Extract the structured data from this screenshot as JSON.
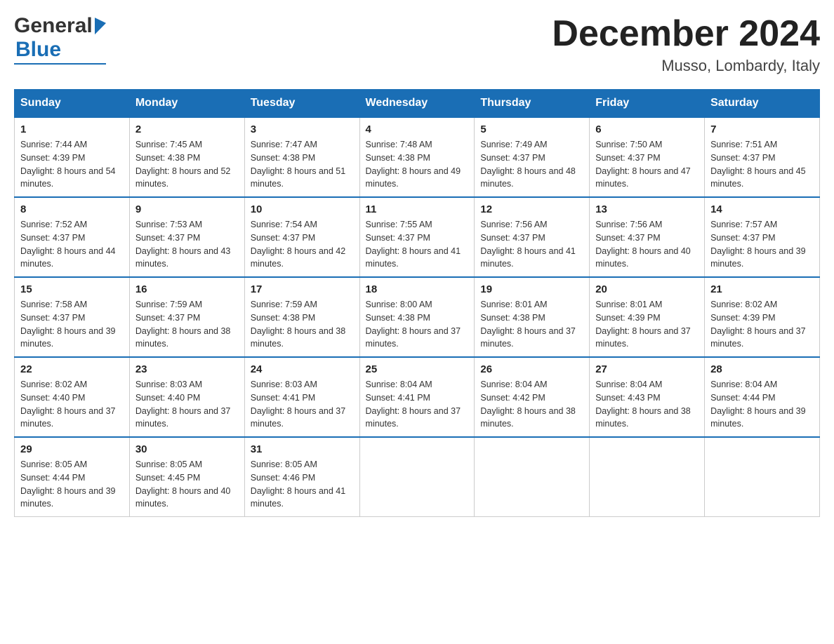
{
  "header": {
    "month_title": "December 2024",
    "location": "Musso, Lombardy, Italy",
    "logo_general": "General",
    "logo_blue": "Blue"
  },
  "calendar": {
    "days_of_week": [
      "Sunday",
      "Monday",
      "Tuesday",
      "Wednesday",
      "Thursday",
      "Friday",
      "Saturday"
    ],
    "weeks": [
      [
        {
          "day": "1",
          "sunrise": "7:44 AM",
          "sunset": "4:39 PM",
          "daylight": "8 hours and 54 minutes."
        },
        {
          "day": "2",
          "sunrise": "7:45 AM",
          "sunset": "4:38 PM",
          "daylight": "8 hours and 52 minutes."
        },
        {
          "day": "3",
          "sunrise": "7:47 AM",
          "sunset": "4:38 PM",
          "daylight": "8 hours and 51 minutes."
        },
        {
          "day": "4",
          "sunrise": "7:48 AM",
          "sunset": "4:38 PM",
          "daylight": "8 hours and 49 minutes."
        },
        {
          "day": "5",
          "sunrise": "7:49 AM",
          "sunset": "4:37 PM",
          "daylight": "8 hours and 48 minutes."
        },
        {
          "day": "6",
          "sunrise": "7:50 AM",
          "sunset": "4:37 PM",
          "daylight": "8 hours and 47 minutes."
        },
        {
          "day": "7",
          "sunrise": "7:51 AM",
          "sunset": "4:37 PM",
          "daylight": "8 hours and 45 minutes."
        }
      ],
      [
        {
          "day": "8",
          "sunrise": "7:52 AM",
          "sunset": "4:37 PM",
          "daylight": "8 hours and 44 minutes."
        },
        {
          "day": "9",
          "sunrise": "7:53 AM",
          "sunset": "4:37 PM",
          "daylight": "8 hours and 43 minutes."
        },
        {
          "day": "10",
          "sunrise": "7:54 AM",
          "sunset": "4:37 PM",
          "daylight": "8 hours and 42 minutes."
        },
        {
          "day": "11",
          "sunrise": "7:55 AM",
          "sunset": "4:37 PM",
          "daylight": "8 hours and 41 minutes."
        },
        {
          "day": "12",
          "sunrise": "7:56 AM",
          "sunset": "4:37 PM",
          "daylight": "8 hours and 41 minutes."
        },
        {
          "day": "13",
          "sunrise": "7:56 AM",
          "sunset": "4:37 PM",
          "daylight": "8 hours and 40 minutes."
        },
        {
          "day": "14",
          "sunrise": "7:57 AM",
          "sunset": "4:37 PM",
          "daylight": "8 hours and 39 minutes."
        }
      ],
      [
        {
          "day": "15",
          "sunrise": "7:58 AM",
          "sunset": "4:37 PM",
          "daylight": "8 hours and 39 minutes."
        },
        {
          "day": "16",
          "sunrise": "7:59 AM",
          "sunset": "4:37 PM",
          "daylight": "8 hours and 38 minutes."
        },
        {
          "day": "17",
          "sunrise": "7:59 AM",
          "sunset": "4:38 PM",
          "daylight": "8 hours and 38 minutes."
        },
        {
          "day": "18",
          "sunrise": "8:00 AM",
          "sunset": "4:38 PM",
          "daylight": "8 hours and 37 minutes."
        },
        {
          "day": "19",
          "sunrise": "8:01 AM",
          "sunset": "4:38 PM",
          "daylight": "8 hours and 37 minutes."
        },
        {
          "day": "20",
          "sunrise": "8:01 AM",
          "sunset": "4:39 PM",
          "daylight": "8 hours and 37 minutes."
        },
        {
          "day": "21",
          "sunrise": "8:02 AM",
          "sunset": "4:39 PM",
          "daylight": "8 hours and 37 minutes."
        }
      ],
      [
        {
          "day": "22",
          "sunrise": "8:02 AM",
          "sunset": "4:40 PM",
          "daylight": "8 hours and 37 minutes."
        },
        {
          "day": "23",
          "sunrise": "8:03 AM",
          "sunset": "4:40 PM",
          "daylight": "8 hours and 37 minutes."
        },
        {
          "day": "24",
          "sunrise": "8:03 AM",
          "sunset": "4:41 PM",
          "daylight": "8 hours and 37 minutes."
        },
        {
          "day": "25",
          "sunrise": "8:04 AM",
          "sunset": "4:41 PM",
          "daylight": "8 hours and 37 minutes."
        },
        {
          "day": "26",
          "sunrise": "8:04 AM",
          "sunset": "4:42 PM",
          "daylight": "8 hours and 38 minutes."
        },
        {
          "day": "27",
          "sunrise": "8:04 AM",
          "sunset": "4:43 PM",
          "daylight": "8 hours and 38 minutes."
        },
        {
          "day": "28",
          "sunrise": "8:04 AM",
          "sunset": "4:44 PM",
          "daylight": "8 hours and 39 minutes."
        }
      ],
      [
        {
          "day": "29",
          "sunrise": "8:05 AM",
          "sunset": "4:44 PM",
          "daylight": "8 hours and 39 minutes."
        },
        {
          "day": "30",
          "sunrise": "8:05 AM",
          "sunset": "4:45 PM",
          "daylight": "8 hours and 40 minutes."
        },
        {
          "day": "31",
          "sunrise": "8:05 AM",
          "sunset": "4:46 PM",
          "daylight": "8 hours and 41 minutes."
        },
        null,
        null,
        null,
        null
      ]
    ]
  }
}
